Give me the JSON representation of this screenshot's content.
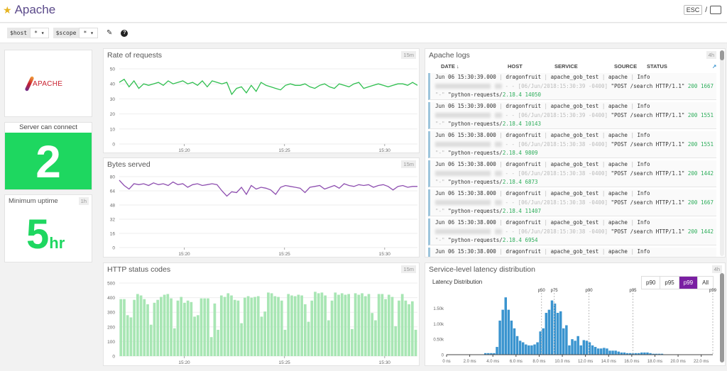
{
  "header": {
    "title": "Apache",
    "esc_label": "ESC",
    "separator": "/"
  },
  "toolbar": {
    "vars": [
      {
        "name": "$host",
        "value": "*"
      },
      {
        "name": "$scope",
        "value": "*"
      }
    ]
  },
  "logo": {
    "text": "APACHE"
  },
  "server_connect": {
    "title": "Server can connect",
    "value": "2",
    "color": "#1ed760"
  },
  "uptime": {
    "title": "Minimum uptime",
    "badge": "1h",
    "value": "5",
    "unit": "hr"
  },
  "logs": {
    "title": "Apache logs",
    "badge": "4h",
    "columns": [
      "DATE ↓",
      "HOST",
      "SERVICE",
      "SOURCE",
      "STATUS"
    ],
    "entries": [
      {
        "date": "Jun 06 15:30:39.000",
        "host": "dragonfruit",
        "service": "apache_gob_test",
        "source": "apache",
        "status": "Info",
        "ts": "[06/Jun/2018:15:30:39 -0400]",
        "req": "\"POST /search HTTP/1.1\"",
        "code": "200",
        "size": "1667",
        "ref": "\"-\"",
        "ua": "\"python-requests/",
        "ver": "2.18.4",
        "tail": "14050"
      },
      {
        "date": "Jun 06 15:30:39.000",
        "host": "dragonfruit",
        "service": "apache_gob_test",
        "source": "apache",
        "status": "Info",
        "ts": "[06/Jun/2018:15:30:39 -0400]",
        "req": "\"POST /search HTTP/1.1\"",
        "code": "200",
        "size": "1551",
        "ref": "\"-\"",
        "ua": "\"python-requests/",
        "ver": "2.18.4",
        "tail": "10143"
      },
      {
        "date": "Jun 06 15:30:38.000",
        "host": "dragonfruit",
        "service": "apache_gob_test",
        "source": "apache",
        "status": "Info",
        "ts": "[06/Jun/2018:15:30:38 -0400]",
        "req": "\"POST /search HTTP/1.1\"",
        "code": "200",
        "size": "1551",
        "ref": "\"-\"",
        "ua": "\"python-requests/",
        "ver": "2.18.4",
        "tail": "9809"
      },
      {
        "date": "Jun 06 15:30:38.000",
        "host": "dragonfruit",
        "service": "apache_gob_test",
        "source": "apache",
        "status": "Info",
        "ts": "[06/Jun/2018:15:30:38 -0400]",
        "req": "\"POST /search HTTP/1.1\"",
        "code": "200",
        "size": "1442",
        "ref": "\"-\"",
        "ua": "\"python-requests/",
        "ver": "2.18.4",
        "tail": "6873"
      },
      {
        "date": "Jun 06 15:30:38.000",
        "host": "dragonfruit",
        "service": "apache_gob_test",
        "source": "apache",
        "status": "Info",
        "ts": "[06/Jun/2018:15:30:38 -0400]",
        "req": "\"POST /search HTTP/1.1\"",
        "code": "200",
        "size": "1667",
        "ref": "\"-\"",
        "ua": "\"python-requests/",
        "ver": "2.18.4",
        "tail": "11407"
      },
      {
        "date": "Jun 06 15:30:38.000",
        "host": "dragonfruit",
        "service": "apache_gob_test",
        "source": "apache",
        "status": "Info",
        "ts": "[06/Jun/2018:15:30:38 -0400]",
        "req": "\"POST /search HTTP/1.1\"",
        "code": "200",
        "size": "1442",
        "ref": "\"-\"",
        "ua": "\"python-requests/",
        "ver": "2.18.4",
        "tail": "6954"
      },
      {
        "date": "Jun 06 15:30:38.000",
        "host": "dragonfruit",
        "service": "apache_gob_test",
        "source": "apache",
        "status": "Info"
      }
    ]
  },
  "latency": {
    "title": "Service-level latency distribution",
    "badge": "4h",
    "subtitle": "Latency Distribution",
    "buttons": [
      "p90",
      "p95",
      "p99",
      "All"
    ],
    "active": "p99"
  },
  "chart_data": [
    {
      "type": "line",
      "title": "Rate of requests",
      "badge": "15m",
      "ylim": [
        0,
        50
      ],
      "yticks": [
        0,
        10,
        20,
        30,
        40,
        50
      ],
      "xticks": [
        "15:20",
        "15:25",
        "15:30"
      ],
      "color": "#2fbf4f",
      "values": [
        41,
        43,
        38,
        42,
        37,
        40,
        39,
        40,
        41,
        39,
        42,
        40,
        41,
        42,
        40,
        41,
        39,
        42,
        38,
        42,
        41,
        40,
        41,
        33,
        37,
        38,
        34,
        39,
        35,
        41,
        39,
        38,
        37,
        36,
        39,
        40,
        39,
        39,
        40,
        38,
        37,
        39,
        40,
        38,
        37,
        40,
        39,
        38,
        40,
        41,
        37,
        38,
        39,
        40,
        39,
        38,
        39,
        40,
        40,
        39,
        41,
        39
      ]
    },
    {
      "type": "line",
      "title": "Bytes served",
      "badge": "15m",
      "ylim": [
        0,
        80
      ],
      "yticks": [
        0,
        16,
        32,
        48,
        64,
        80
      ],
      "xticks": [
        "15:20",
        "15:25",
        "15:30"
      ],
      "color": "#8e4fb0",
      "values": [
        76,
        70,
        66,
        72,
        71,
        72,
        70,
        73,
        71,
        72,
        70,
        74,
        71,
        72,
        68,
        71,
        72,
        70,
        71,
        72,
        71,
        64,
        58,
        63,
        62,
        68,
        60,
        70,
        66,
        68,
        67,
        65,
        60,
        68,
        70,
        69,
        68,
        67,
        62,
        68,
        69,
        70,
        66,
        68,
        70,
        67,
        72,
        70,
        69,
        71,
        70,
        71,
        68,
        70,
        71,
        69,
        65,
        69,
        70,
        68,
        69,
        69
      ]
    },
    {
      "type": "bar",
      "title": "HTTP status codes",
      "badge": "15m",
      "ylim": [
        0,
        500
      ],
      "yticks": [
        0,
        100,
        200,
        300,
        400,
        500
      ],
      "xticks": [
        "15:20",
        "15:25",
        "15:30"
      ],
      "color": "#a8e6b4",
      "values": [
        390,
        390,
        280,
        265,
        385,
        425,
        415,
        390,
        355,
        215,
        365,
        385,
        405,
        420,
        425,
        395,
        190,
        380,
        405,
        365,
        380,
        370,
        270,
        280,
        395,
        395,
        395,
        130,
        360,
        180,
        415,
        405,
        430,
        415,
        385,
        380,
        225,
        400,
        410,
        400,
        405,
        410,
        270,
        305,
        435,
        430,
        410,
        405,
        380,
        180,
        425,
        415,
        410,
        420,
        415,
        355,
        235,
        380,
        440,
        430,
        435,
        415,
        245,
        380,
        435,
        420,
        430,
        420,
        425,
        185,
        430,
        420,
        430,
        410,
        425,
        295,
        245,
        425,
        425,
        390,
        420,
        405,
        205,
        380,
        425,
        380,
        355,
        375,
        180
      ]
    },
    {
      "type": "bar",
      "title": "Latency Distribution",
      "xlim": [
        0,
        23
      ],
      "ylim": [
        0,
        1.9
      ],
      "yticks": [
        "0",
        "0.50k",
        "1.00k",
        "1.50k"
      ],
      "ytick_values": [
        0,
        0.5,
        1.0,
        1.5
      ],
      "xticks": [
        "0 ns",
        "2.0 ms",
        "4.0 ms",
        "6.0 ms",
        "8.0 ms",
        "10.0 ms",
        "12.0 ms",
        "14.0 ms",
        "16.0 ms",
        "18.0 ms",
        "20.0 ms",
        "22.0 ms"
      ],
      "bin_start_ms": 3.25,
      "bin_width_ms": 0.25,
      "color": "#3a94cf",
      "values_k": [
        0.05,
        0.05,
        0.05,
        0.05,
        0.25,
        1.1,
        1.45,
        1.85,
        1.45,
        1.1,
        0.85,
        0.6,
        0.45,
        0.4,
        0.33,
        0.3,
        0.3,
        0.33,
        0.4,
        0.75,
        0.85,
        1.35,
        1.45,
        1.75,
        1.65,
        1.35,
        1.4,
        0.85,
        0.95,
        0.3,
        0.5,
        0.45,
        0.6,
        0.3,
        0.47,
        0.45,
        0.4,
        0.3,
        0.25,
        0.2,
        0.2,
        0.22,
        0.2,
        0.13,
        0.13,
        0.13,
        0.1,
        0.07,
        0.07,
        0.05,
        0.05,
        0.05,
        0.05,
        0.05,
        0.07,
        0.07,
        0.07,
        0.05,
        0.03,
        0.03,
        0.03,
        0.03
      ],
      "percentiles": [
        {
          "label": "p50",
          "ms": 8.2
        },
        {
          "label": "p75",
          "ms": 9.3
        },
        {
          "label": "p90",
          "ms": 12.3
        },
        {
          "label": "p95",
          "ms": 16.1
        },
        {
          "label": "p99",
          "ms": 23.0
        }
      ]
    }
  ]
}
